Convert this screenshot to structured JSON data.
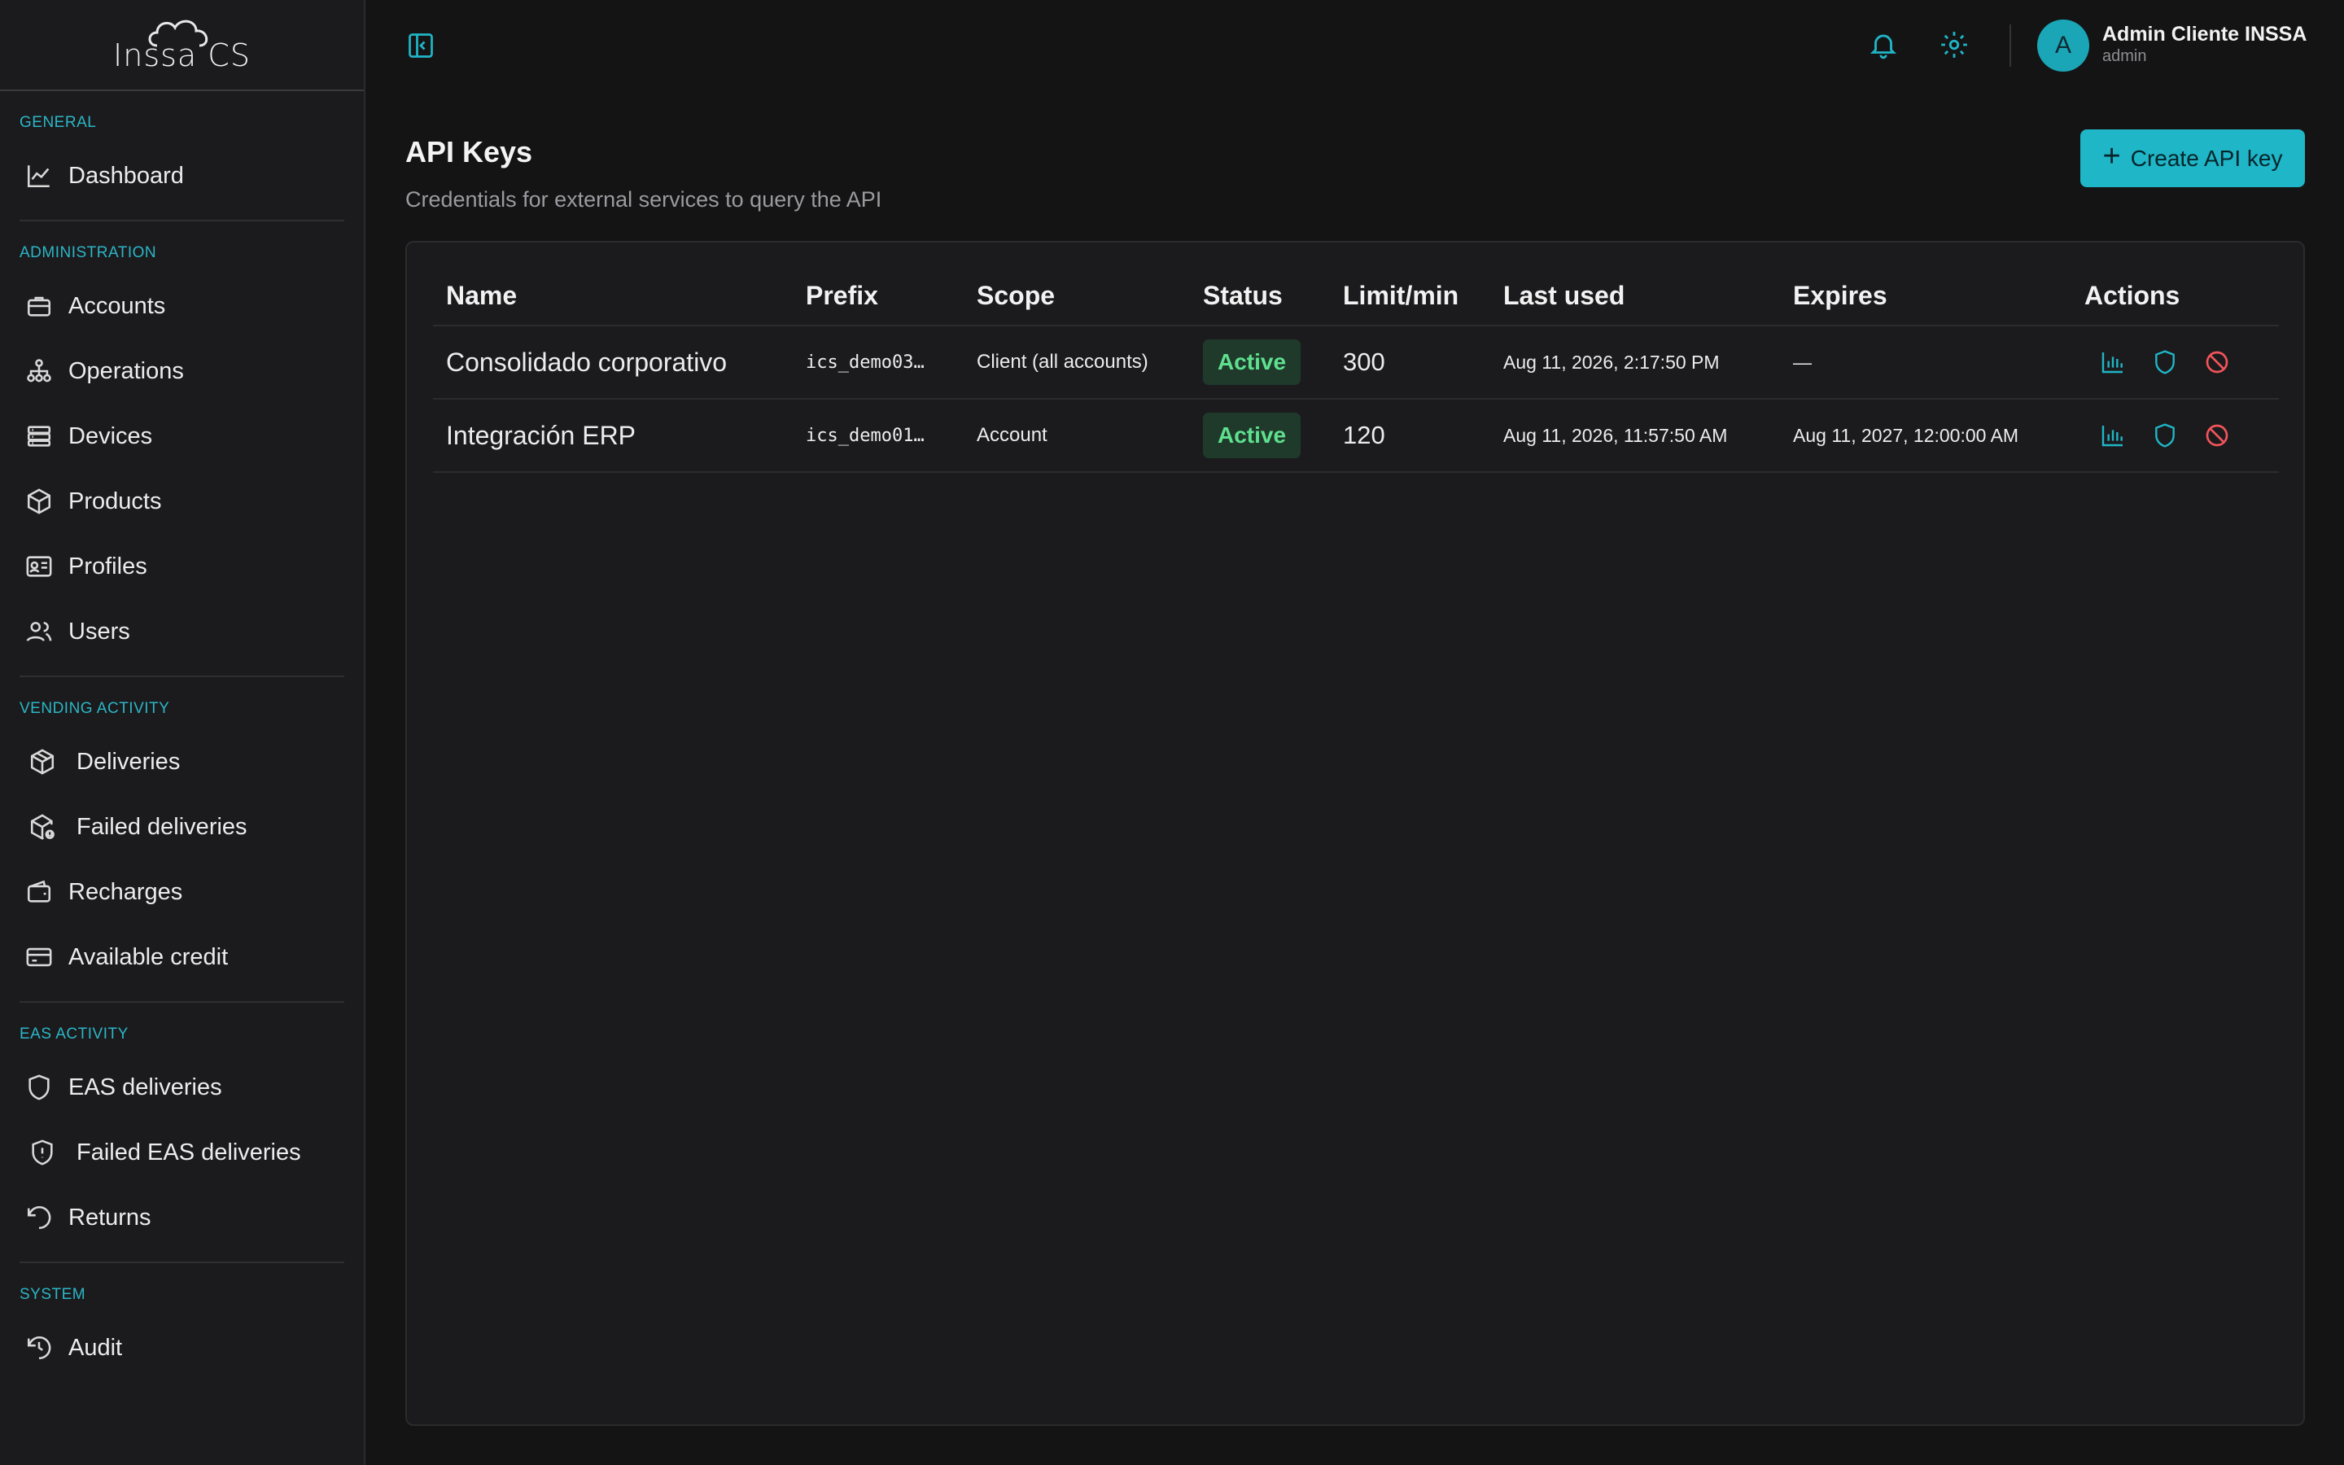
{
  "app": {
    "logo_text": "Inssa CS"
  },
  "sidebar": {
    "sections": [
      {
        "title": "GENERAL",
        "items": [
          {
            "label": "Dashboard",
            "icon": "chart-line-icon"
          }
        ]
      },
      {
        "title": "ADMINISTRATION",
        "items": [
          {
            "label": "Accounts",
            "icon": "briefcase-icon"
          },
          {
            "label": "Operations",
            "icon": "hierarchy-icon"
          },
          {
            "label": "Devices",
            "icon": "server-icon"
          },
          {
            "label": "Products",
            "icon": "box-icon"
          },
          {
            "label": "Profiles",
            "icon": "id-card-icon"
          },
          {
            "label": "Users",
            "icon": "users-icon"
          }
        ]
      },
      {
        "title": "VENDING ACTIVITY",
        "items": [
          {
            "label": "Deliveries",
            "icon": "package-icon"
          },
          {
            "label": "Failed deliveries",
            "icon": "package-alert-icon"
          },
          {
            "label": "Recharges",
            "icon": "wallet-icon"
          },
          {
            "label": "Available credit",
            "icon": "credit-card-icon"
          }
        ]
      },
      {
        "title": "EAS ACTIVITY",
        "items": [
          {
            "label": "EAS deliveries",
            "icon": "shield-icon"
          },
          {
            "label": "Failed EAS deliveries",
            "icon": "shield-alert-icon"
          },
          {
            "label": "Returns",
            "icon": "rotate-ccw-icon"
          }
        ]
      },
      {
        "title": "SYSTEM",
        "items": [
          {
            "label": "Audit",
            "icon": "history-icon"
          }
        ]
      }
    ]
  },
  "header": {
    "user_initial": "A",
    "user_name": "Admin Cliente INSSA",
    "user_role": "admin"
  },
  "page": {
    "title": "API Keys",
    "subtitle": "Credentials for external services to query the API",
    "create_button_label": "Create API key"
  },
  "table": {
    "columns": [
      "Name",
      "Prefix",
      "Scope",
      "Status",
      "Limit/min",
      "Last used",
      "Expires",
      "Actions"
    ],
    "rows": [
      {
        "name": "Consolidado corporativo",
        "prefix": "ics_demo03…",
        "scope": "Client (all accounts)",
        "status": "Active",
        "limit": "300",
        "last_used": "Aug 11, 2026, 2:17:50 PM",
        "expires": "—"
      },
      {
        "name": "Integración ERP",
        "prefix": "ics_demo01…",
        "scope": "Account",
        "status": "Active",
        "limit": "120",
        "last_used": "Aug 11, 2026, 11:57:50 AM",
        "expires": "Aug 11, 2027, 12:00:00 AM"
      }
    ]
  },
  "colors": {
    "accent": "#1fb6c7",
    "active_text": "#5fe08f",
    "active_bg": "#1f3a2b",
    "danger": "#f2545b"
  }
}
